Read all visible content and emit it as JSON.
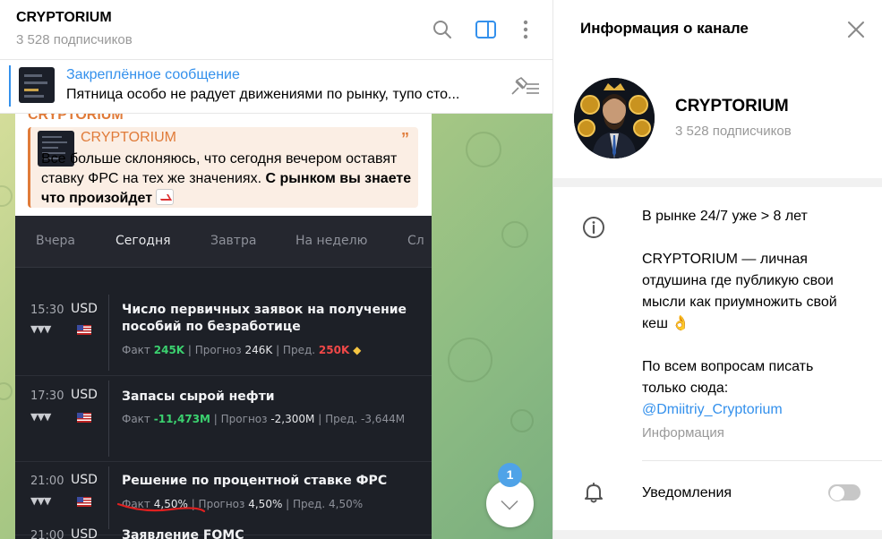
{
  "header": {
    "title": "CRYPTORIUM",
    "subscribers": "3 528 подписчиков"
  },
  "pinned": {
    "label": "Закреплённое сообщение",
    "text": "Пятница особо не радует движениями по рынку, тупо сто..."
  },
  "message": {
    "author_cut": "CRYPTORIUM",
    "reply_author": "CRYPTORIUM",
    "reply_quote_mark": "”",
    "reply_text": "Все больше склоняюсь, что сегодня вечером оставят ставку ФРС на тех же значениях.",
    "reply_bold": "С рынком вы знаете что произойдет"
  },
  "calendar": {
    "tabs": [
      "Вчера",
      "Сегодня",
      "Завтра",
      "На неделю",
      "Сл"
    ],
    "active_tab": "Сегодня",
    "events": [
      {
        "time": "15:30",
        "currency": "USD",
        "impact": "▼▼▼",
        "name": "Число первичных заявок на получение пособий по безработице",
        "fact_label": "Факт",
        "fact": "245K",
        "forecast_label": "Прогноз",
        "forecast": "246K",
        "prev_label": "Пред.",
        "prev": "250K",
        "prev_mark": "◆"
      },
      {
        "time": "17:30",
        "currency": "USD",
        "impact": "▼▼▼",
        "name": "Запасы сырой нефти",
        "fact_label": "Факт",
        "fact": "-11,473M",
        "forecast_label": "Прогноз",
        "forecast": "-2,300M",
        "prev_label": "Пред.",
        "prev": "-3,644M"
      },
      {
        "time": "21:00",
        "currency": "USD",
        "impact": "▼▼▼",
        "name": "Решение по процентной ставке ФРС",
        "fact_label": "Факт",
        "fact": "4,50%",
        "forecast_label": "Прогноз",
        "forecast": "4,50%",
        "prev_label": "Пред.",
        "prev": "4,50%"
      },
      {
        "time": "21:00",
        "currency": "USD",
        "name": "Заявление FOMC"
      }
    ]
  },
  "scroll": {
    "unread_count": "1"
  },
  "info": {
    "title": "Информация о канале",
    "channel_name": "CRYPTORIUM",
    "subscribers": "3 528 подписчиков",
    "about_line1": "В рынке 24/7 уже > 8 лет",
    "about_line2": "CRYPTORIUM — личная отдушина где публикую свои мысли как приумножить свой кеш 👌",
    "about_line3": "По всем вопросам писать только сюда:",
    "link": "@Dmiitriy_Cryptorium",
    "about_caption": "Информация",
    "notifications_label": "Уведомления",
    "notifications_on": false
  },
  "colors": {
    "accent": "#3390ec",
    "author": "#e07b39",
    "positive": "#3bd16f",
    "negative": "#f04848"
  }
}
